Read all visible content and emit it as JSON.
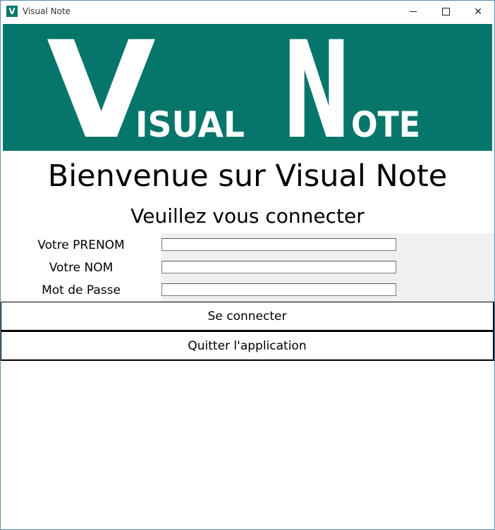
{
  "window": {
    "app_icon_letter": "V",
    "title": "Visual Note",
    "minimize_label": "",
    "maximize_label": "",
    "close_label": "✕"
  },
  "banner": {
    "background": "#06766a",
    "logo_letter_1": "V",
    "logo_word_1": "ISUAL",
    "logo_letter_2": "N",
    "logo_word_2": "OTE"
  },
  "main": {
    "welcome": "Bienvenue sur Visual Note",
    "subtitle": "Veuillez vous connecter"
  },
  "form": {
    "first_name_label": "Votre PRENOM",
    "first_name_value": "",
    "last_name_label": "Votre NOM",
    "last_name_value": "",
    "password_label": "Mot de Passe",
    "password_value": ""
  },
  "buttons": {
    "login": "Se connecter",
    "quit": "Quitter l'application"
  }
}
